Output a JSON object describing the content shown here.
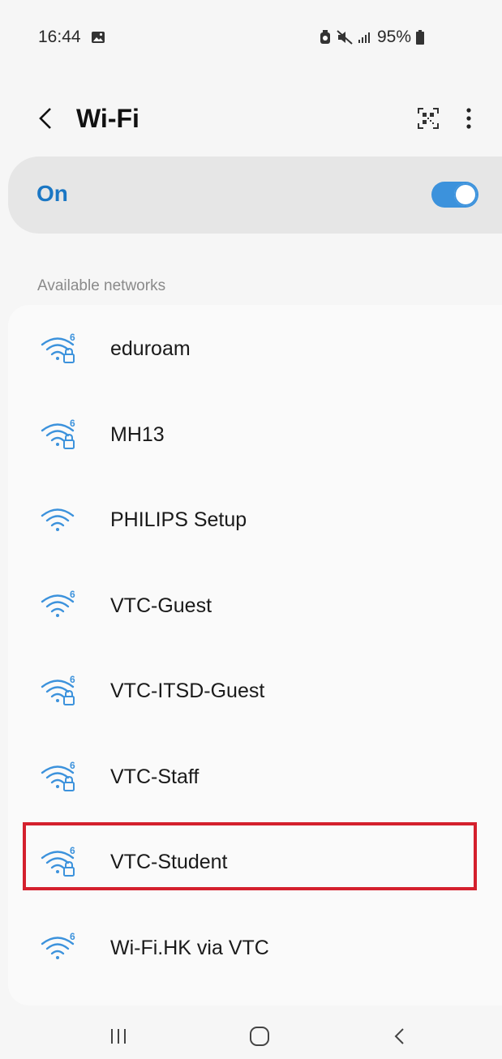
{
  "status_bar": {
    "time": "16:44",
    "battery": "95%",
    "icons": [
      "image-icon",
      "alarm-icon",
      "mute-icon",
      "signal-icon",
      "battery-icon"
    ]
  },
  "header": {
    "title": "Wi-Fi",
    "icons": [
      "back-arrow-icon",
      "qr-code-icon",
      "more-options-icon"
    ]
  },
  "wifi_toggle": {
    "label": "On",
    "state": "on",
    "accent": "#3c92dc",
    "label_color": "#1b77c4"
  },
  "section_title": "Available networks",
  "networks": [
    {
      "name": "eduroam",
      "wifi6": true,
      "locked": true
    },
    {
      "name": "MH13",
      "wifi6": true,
      "locked": true
    },
    {
      "name": "PHILIPS Setup",
      "wifi6": false,
      "locked": false
    },
    {
      "name": "VTC-Guest",
      "wifi6": true,
      "locked": false
    },
    {
      "name": "VTC-ITSD-Guest",
      "wifi6": true,
      "locked": true
    },
    {
      "name": "VTC-Staff",
      "wifi6": true,
      "locked": true
    },
    {
      "name": "VTC-Student",
      "wifi6": true,
      "locked": true,
      "highlighted": true
    },
    {
      "name": "Wi-Fi.HK via VTC",
      "wifi6": true,
      "locked": false
    }
  ],
  "highlight_color": "#d4202d",
  "nav_bar": {
    "icons": [
      "recent-apps-icon",
      "home-icon",
      "back-icon"
    ]
  }
}
